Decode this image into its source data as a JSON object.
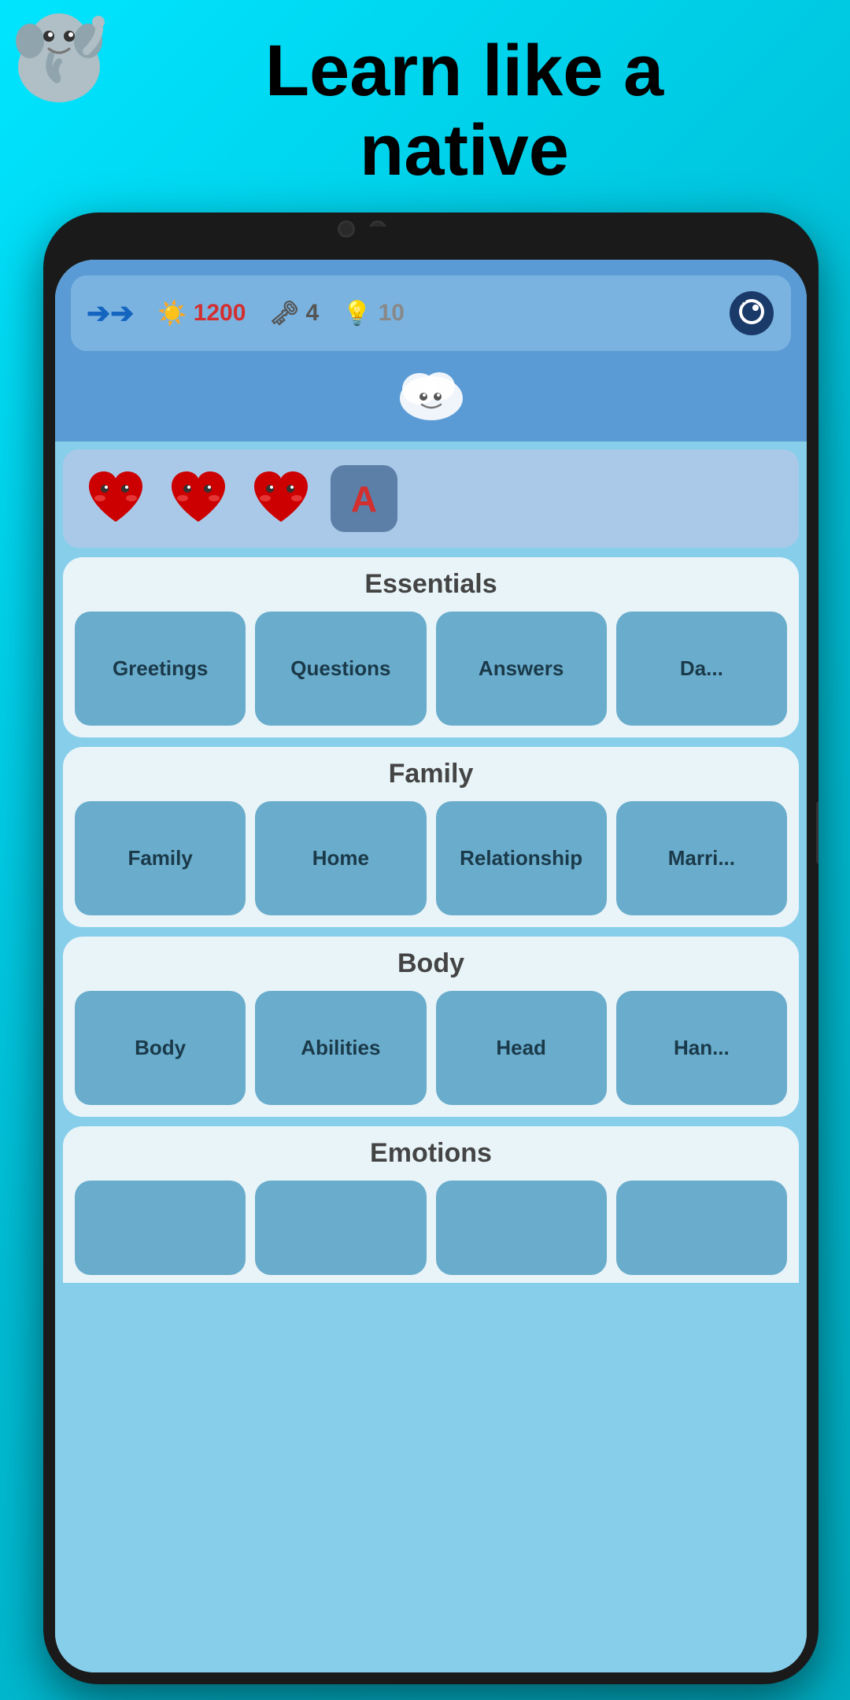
{
  "headline": {
    "line1": "Learn like a",
    "line2": "native"
  },
  "stats": {
    "sun_icon": "☀️",
    "sun_value": "1200",
    "key_icon": "🗝",
    "key_value": "4",
    "bulb_icon": "💡",
    "bulb_value": "10"
  },
  "sections": [
    {
      "id": "essentials",
      "title": "Essentials",
      "cards": [
        "Greetings",
        "Questions",
        "Answers",
        "Da..."
      ]
    },
    {
      "id": "family",
      "title": "Family",
      "cards": [
        "Family",
        "Home",
        "Relationship",
        "Marri..."
      ]
    },
    {
      "id": "body",
      "title": "Body",
      "cards": [
        "Body",
        "Abilities",
        "Head",
        "Han..."
      ]
    },
    {
      "id": "emotions",
      "title": "Emotions",
      "cards": []
    }
  ],
  "lives": {
    "count": 3,
    "letter": "A"
  }
}
